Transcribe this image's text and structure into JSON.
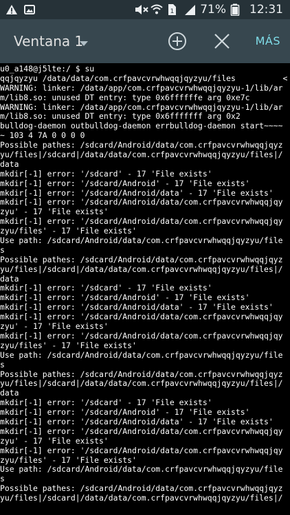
{
  "status_bar": {
    "battery_percent": "71%",
    "time": "12:31",
    "icons": [
      "warning-icon",
      "image-icon",
      "mute-icon",
      "wifi-icon",
      "sim-icon",
      "signal-icon",
      "battery-icon"
    ]
  },
  "app_bar": {
    "title": "Ventana 1",
    "more_label": "MÁS",
    "icons": [
      "dropdown-arrow-icon",
      "add-circle-icon",
      "close-icon"
    ]
  },
  "terminal_lines": [
    "u0_a148@j5lte:/ $ su",
    "qqjqyzyu /data/data/com.crfpavcvrwhwqqjqyzyu/files          <",
    "WARNING: linker: /data/app/com.crfpavcvrwhwqqjqyzyu-1/lib/ar",
    "m/lib8.so: unused DT entry: type 0x6ffffffe arg 0xe7c",
    "WARNING: linker: /data/app/com.crfpavcvrwhwqqjqyzyu-1/lib/ar",
    "m/lib8.so: unused DT entry: type 0x6fffffff arg 0x2",
    "bulldog-daemon outbulldog-daemon errbulldog-daemon start~~~~",
    "~ 103 4 7A 0 0 0 0",
    "Possible pathes: /sdcard/Android/data/com.crfpavcvrwhwqqjqyz",
    "yu/files|/sdcard|/data/data/com.crfpavcvrwhwqqjqyzyu/files|/",
    "data",
    "mkdir[-1] error: '/sdcard' - 17 'File exists'",
    "mkdir[-1] error: '/sdcard/Android' - 17 'File exists'",
    "mkdir[-1] error: '/sdcard/Android/data' - 17 'File exists'",
    "mkdir[-1] error: '/sdcard/Android/data/com.crfpavcvrwhwqqjqy",
    "zyu' - 17 'File exists'",
    "mkdir[-1] error: '/sdcard/Android/data/com.crfpavcvrwhwqqjqy",
    "zyu/files' - 17 'File exists'",
    "Use path: /sdcard/Android/data/com.crfpavcvrwhwqqjqyzyu/file",
    "s",
    "Possible pathes: /sdcard/Android/data/com.crfpavcvrwhwqqjqyz",
    "yu/files|/sdcard|/data/data/com.crfpavcvrwhwqqjqyzyu/files|/",
    "data",
    "mkdir[-1] error: '/sdcard' - 17 'File exists'",
    "mkdir[-1] error: '/sdcard/Android' - 17 'File exists'",
    "mkdir[-1] error: '/sdcard/Android/data' - 17 'File exists'",
    "mkdir[-1] error: '/sdcard/Android/data/com.crfpavcvrwhwqqjqy",
    "zyu' - 17 'File exists'",
    "mkdir[-1] error: '/sdcard/Android/data/com.crfpavcvrwhwqqjqy",
    "zyu/files' - 17 'File exists'",
    "Use path: /sdcard/Android/data/com.crfpavcvrwhwqqjqyzyu/file",
    "s",
    "Possible pathes: /sdcard/Android/data/com.crfpavcvrwhwqqjqyz",
    "yu/files|/sdcard|/data/data/com.crfpavcvrwhwqqjqyzyu/files|/",
    "data",
    "mkdir[-1] error: '/sdcard' - 17 'File exists'",
    "mkdir[-1] error: '/sdcard/Android' - 17 'File exists'",
    "mkdir[-1] error: '/sdcard/Android/data' - 17 'File exists'",
    "mkdir[-1] error: '/sdcard/Android/data/com.crfpavcvrwhwqqjqy",
    "zyu' - 17 'File exists'",
    "mkdir[-1] error: '/sdcard/Android/data/com.crfpavcvrwhwqqjqy",
    "zyu/files' - 17 'File exists'",
    "Use path: /sdcard/Android/data/com.crfpavcvrwhwqqjqyzyu/file",
    "s",
    "Possible pathes: /sdcard/Android/data/com.crfpavcvrwhwqqjqyz",
    "yu/files|/sdcard|/data/data/com.crfpavcvrwhwqqjqyzyu/files|/"
  ],
  "colors": {
    "status_bar_bg": "#263238",
    "app_bar_bg": "#37474f",
    "accent": "#80deea",
    "terminal_bg": "#000000",
    "terminal_text": "#ffffff"
  }
}
